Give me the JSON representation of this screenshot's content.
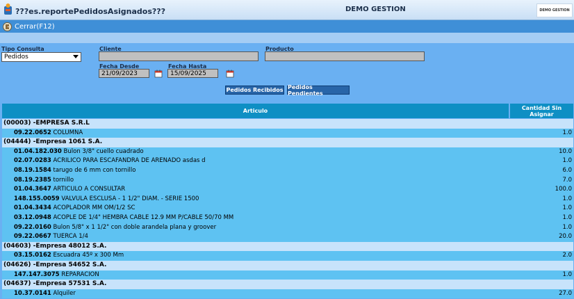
{
  "app": {
    "title": "???es.reportePedidosAsignados???",
    "company": "DEMO GESTION",
    "logo_text": "DEMO GESTION"
  },
  "toolbar": {
    "close_label": "Cerrar(F12)"
  },
  "filters": {
    "tipo_consulta": {
      "label": "Tipo Consulta",
      "value": "Pedidos"
    },
    "cliente": {
      "label": "Cliente",
      "value": ""
    },
    "producto": {
      "label": "Producto",
      "value": ""
    },
    "fecha_desde": {
      "label": "Fecha Desde",
      "value": "21/09/2023"
    },
    "fecha_hasta": {
      "label": "Fecha Hasta",
      "value": "15/09/2025"
    }
  },
  "buttons": {
    "recibidos": "Pedidos Recibidos",
    "pendientes": "Pedidos Pendientes"
  },
  "grid": {
    "col_articulo": "Articulo",
    "col_cantidad_1": "Cantidad Sin",
    "col_cantidad_2": "Asignar"
  },
  "groups": [
    {
      "name": "(00003) -EMPRESA S.R.L",
      "items": [
        {
          "code": "09.22.0652",
          "desc": "COLUMNA",
          "qty": "1.0"
        }
      ]
    },
    {
      "name": "(04444) -Empresa 1061 S.A.",
      "items": [
        {
          "code": "01.04.182.030",
          "desc": "Bulon 3/8\" cuello cuadrado",
          "qty": "10.0"
        },
        {
          "code": "02.07.0283",
          "desc": "ACRILICO PARA ESCAFANDRA DE ARENADO asdas d",
          "qty": "1.0"
        },
        {
          "code": "08.19.1584",
          "desc": "tarugo de 6 mm con tornillo",
          "qty": "6.0"
        },
        {
          "code": "08.19.2385",
          "desc": "tornillo",
          "qty": "7.0"
        },
        {
          "code": "01.04.3647",
          "desc": "ARTICULO A CONSULTAR",
          "qty": "100.0"
        },
        {
          "code": "148.155.0059",
          "desc": "VALVULA ESCLUSA - 1 1/2\" DIAM. - SERIE 1500",
          "qty": "1.0"
        },
        {
          "code": "01.04.3434",
          "desc": "ACOPLADOR MM OM/1/2 SC",
          "qty": "1.0"
        },
        {
          "code": "03.12.0948",
          "desc": "ACOPLE DE 1/4\" HEMBRA CABLE 12.9 MM P/CABLE 50/70 MM",
          "qty": "1.0"
        },
        {
          "code": "09.22.0160",
          "desc": "Bulon 5/8\" x 1 1/2\" con doble arandela plana y groover",
          "qty": "1.0"
        },
        {
          "code": "09.22.0667",
          "desc": "TUERCA 1/4",
          "qty": "20.0"
        }
      ]
    },
    {
      "name": "(04603) -Empresa 48012 S.A.",
      "items": [
        {
          "code": "03.15.0162",
          "desc": "Escuadra 45º x 300 Mm",
          "qty": "2.0"
        }
      ]
    },
    {
      "name": "(04626) -Empresa 54652 S.A.",
      "items": [
        {
          "code": "147.147.3075",
          "desc": "REPARACION",
          "qty": "1.0"
        }
      ]
    },
    {
      "name": "(04637) -Empresa 57531 S.A.",
      "items": [
        {
          "code": "10.37.0141",
          "desc": "Alquiler",
          "qty": "27.0"
        }
      ]
    }
  ]
}
